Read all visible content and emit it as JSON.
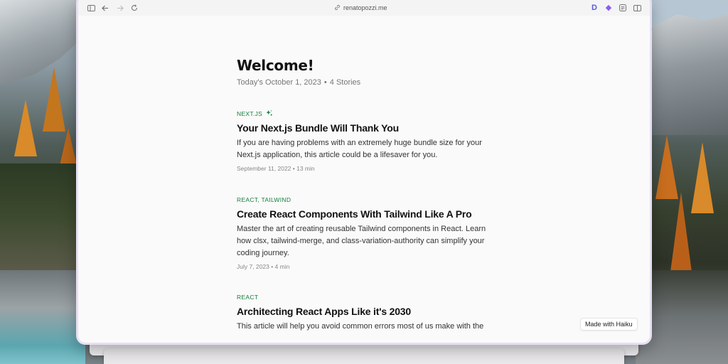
{
  "browser": {
    "url": "renatopozzi.me"
  },
  "page": {
    "title": "Welcome!",
    "date_text": "Today's October 1, 2023",
    "stories_text": "4 Stories"
  },
  "posts": [
    {
      "tag": "NEXT.JS",
      "has_sparkle": true,
      "title": "Your Next.js Bundle Will Thank You",
      "excerpt": "If you are having problems with an extremely huge bundle size for your Next.js application, this article could be a lifesaver for you.",
      "date": "September 11, 2022",
      "read_time": "13 min"
    },
    {
      "tag": "REACT, TAILWIND",
      "has_sparkle": false,
      "title": "Create React Components With Tailwind Like A Pro",
      "excerpt": "Master the art of creating reusable Tailwind components in React. Learn how clsx, tailwind-merge, and class-variation-authority can simplify your coding journey.",
      "date": "July 7, 2023",
      "read_time": "4 min"
    },
    {
      "tag": "REACT",
      "has_sparkle": false,
      "title": "Architecting React Apps Like it's 2030",
      "excerpt": "This article will help you avoid common errors most of us make with the",
      "date": "",
      "read_time": ""
    }
  ],
  "badge": {
    "label": "Made with Haiku"
  },
  "colors": {
    "tag_green": "#15803d",
    "window_glow": "#e6dff2"
  }
}
